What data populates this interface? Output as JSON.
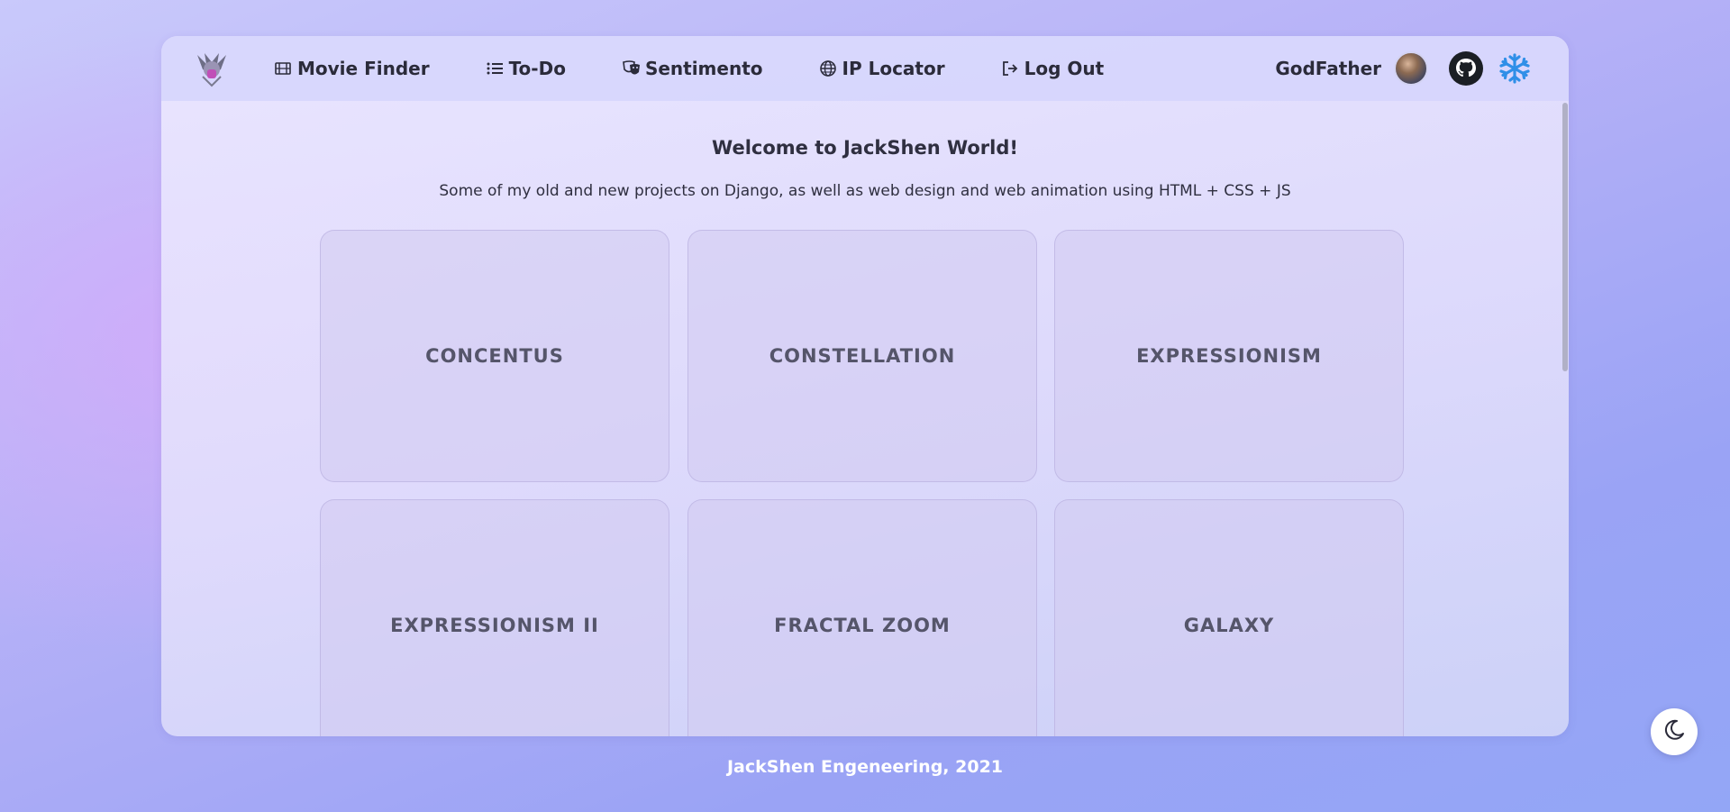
{
  "nav": {
    "items": [
      {
        "label": "Movie Finder",
        "icon": "film-icon"
      },
      {
        "label": "To-Do",
        "icon": "list-icon"
      },
      {
        "label": "Sentimento",
        "icon": "masks-icon"
      },
      {
        "label": "IP Locator",
        "icon": "globe-icon"
      },
      {
        "label": "Log Out",
        "icon": "logout-icon"
      }
    ],
    "username": "GodFather"
  },
  "main": {
    "title": "Welcome to JackShen World!",
    "subtitle": "Some of my old and new projects on Django, as well as web design and web animation using HTML + CSS + JS",
    "cards": [
      {
        "label": "CONCENTUS"
      },
      {
        "label": "CONSTELLATION"
      },
      {
        "label": "EXPRESSIONISM"
      },
      {
        "label": "EXPRESSIONISM II"
      },
      {
        "label": "FRACTAL ZOOM"
      },
      {
        "label": "GALAXY"
      }
    ]
  },
  "footer": {
    "text": "JackShen Engeneering, 2021"
  },
  "colors": {
    "accent_snowflake": "#2f8fe8",
    "text": "#2b2b3a"
  }
}
